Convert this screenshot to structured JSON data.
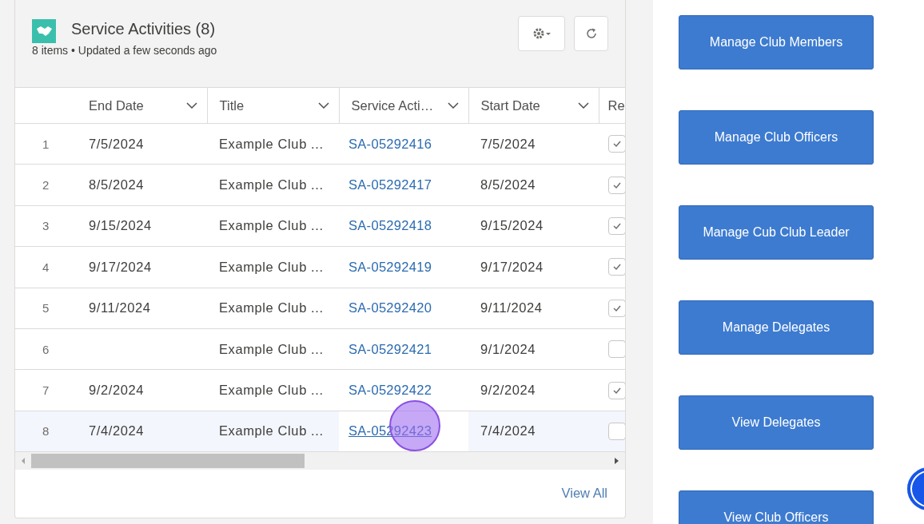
{
  "card": {
    "title": "Service Activities (8)",
    "subtitle": "8 items • Updated a few seconds ago",
    "columns": [
      "End Date",
      "Title",
      "Service Acti…",
      "Start Date",
      "Re"
    ],
    "rows": [
      {
        "number": "1",
        "end_date": "7/5/2024",
        "title": "Example Club ...",
        "service_activity": "SA-05292416",
        "start_date": "7/5/2024",
        "checked": true,
        "hovered": false,
        "clicked": false
      },
      {
        "number": "2",
        "end_date": "8/5/2024",
        "title": "Example Club ...",
        "service_activity": "SA-05292417",
        "start_date": "8/5/2024",
        "checked": true,
        "hovered": false,
        "clicked": false
      },
      {
        "number": "3",
        "end_date": "9/15/2024",
        "title": "Example Club ...",
        "service_activity": "SA-05292418",
        "start_date": "9/15/2024",
        "checked": true,
        "hovered": false,
        "clicked": false
      },
      {
        "number": "4",
        "end_date": "9/17/2024",
        "title": "Example Club ...",
        "service_activity": "SA-05292419",
        "start_date": "9/17/2024",
        "checked": true,
        "hovered": false,
        "clicked": false
      },
      {
        "number": "5",
        "end_date": "9/11/2024",
        "title": "Example Club ...",
        "service_activity": "SA-05292420",
        "start_date": "9/11/2024",
        "checked": true,
        "hovered": false,
        "clicked": false
      },
      {
        "number": "6",
        "title": "Example Club ...",
        "service_activity": "SA-05292421",
        "start_date": "9/1/2024",
        "checked": false,
        "hovered": false,
        "clicked": false
      },
      {
        "number": "7",
        "end_date": "9/2/2024",
        "title": "Example Club ...",
        "service_activity": "SA-05292422",
        "start_date": "9/2/2024",
        "checked": true,
        "hovered": false,
        "clicked": false
      },
      {
        "number": "8",
        "end_date": "7/4/2024",
        "title": "Example Club ...",
        "service_activity": "SA-05292423",
        "start_date": "7/4/2024",
        "checked": false,
        "hovered": true,
        "clicked": true
      }
    ],
    "footer_link": "View All"
  },
  "actions": [
    "Manage Club Members",
    "Manage Club Officers",
    "Manage Cub Club Leader",
    "Manage Delegates",
    "View Delegates",
    "View Club Officers"
  ]
}
